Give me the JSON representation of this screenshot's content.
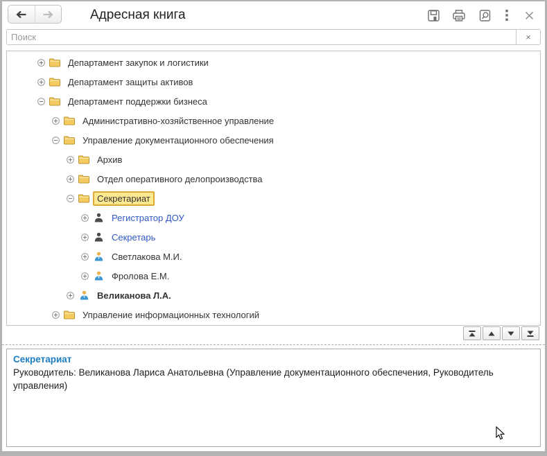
{
  "window": {
    "title": "Адресная книга"
  },
  "toolbar": {
    "back_label": "back-arrow",
    "forward_label": "forward-arrow",
    "icons": [
      "save-icon",
      "print-icon",
      "preview-icon",
      "more-icon",
      "close-icon"
    ]
  },
  "search": {
    "placeholder": "Поиск",
    "clear_label": "×"
  },
  "tree": {
    "items": [
      {
        "label": "Департамент закупок и логистики",
        "level": 1,
        "expander": "plus",
        "icon": "folder"
      },
      {
        "label": "Департамент защиты активов",
        "level": 1,
        "expander": "plus",
        "icon": "folder"
      },
      {
        "label": "Департамент поддержки бизнеса",
        "level": 1,
        "expander": "minus",
        "icon": "folder"
      },
      {
        "label": "Административно-хозяйственное управление",
        "level": 2,
        "expander": "plus",
        "icon": "folder"
      },
      {
        "label": "Управление документационного обеспечения",
        "level": 2,
        "expander": "minus",
        "icon": "folder"
      },
      {
        "label": "Архив",
        "level": 3,
        "expander": "plus",
        "icon": "folder"
      },
      {
        "label": "Отдел оперативного делопроизводства",
        "level": 3,
        "expander": "plus",
        "icon": "folder"
      },
      {
        "label": "Секретариат",
        "level": 3,
        "expander": "minus",
        "icon": "folder",
        "selected": true
      },
      {
        "label": "Регистратор ДОУ",
        "level": 4,
        "expander": "plus",
        "icon": "person-dark",
        "style": "link"
      },
      {
        "label": "Секретарь",
        "level": 4,
        "expander": "plus",
        "icon": "person-dark",
        "style": "link"
      },
      {
        "label": "Светлакова М.И.",
        "level": 4,
        "expander": "plus",
        "icon": "person-blue"
      },
      {
        "label": "Фролова Е.М.",
        "level": 4,
        "expander": "plus",
        "icon": "person-blue"
      },
      {
        "label": "Великанова Л.А.",
        "level": 3,
        "expander": "plus",
        "icon": "person-blue",
        "style": "bold"
      },
      {
        "label": "Управление информационных технологий",
        "level": 2,
        "expander": "plus",
        "icon": "folder"
      }
    ]
  },
  "pager": {
    "buttons": [
      "scroll-to-top",
      "scroll-up",
      "scroll-down",
      "scroll-to-bottom"
    ]
  },
  "info_panel": {
    "title": "Секретариат",
    "text": "Руководитель: Великанова Лариса Анатольевна (Управление документационного обеспечения, Руководитель управления)"
  },
  "colors": {
    "link": "#2e58c8",
    "selected_bg": "#ffe990",
    "selected_border": "#dfa937",
    "panel_title": "#1b7dc2",
    "folder": "#f3cb60",
    "icon_gray": "#6f6f6f"
  }
}
